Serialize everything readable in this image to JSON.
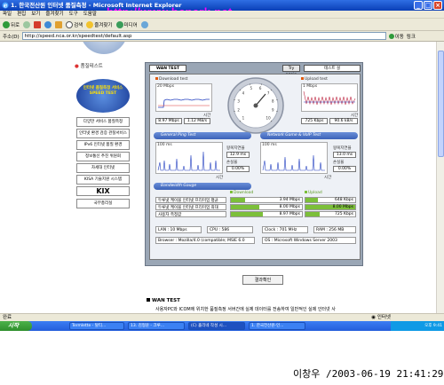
{
  "window": {
    "title": "1. 한국전산원 인터넷 품질측정 - Microsoft Internet Explorer",
    "watermark": "http://www.bcpark.net"
  },
  "menubar": {
    "items": [
      "파일",
      "편집",
      "보기",
      "즐겨찾기",
      "도구",
      "도움말"
    ]
  },
  "toolbar": {
    "back": "뒤로",
    "search": "검색",
    "favorites": "즐겨찾기",
    "media": "미디어"
  },
  "address": {
    "label": "주소(D)",
    "url": "http://speed.nca.or.kr/speedtest/default.asp",
    "go": "이동",
    "links": "링크"
  },
  "sidebar": {
    "title": "품질테스트",
    "banner": "인터넷 품질측정 서비스 SPEED TEST",
    "buttons": [
      {
        "label": "다양한 서비스 품질측정",
        "color": "#ffffff"
      },
      {
        "label": "인터넷 환경 검증 관찰서비스",
        "color": "#e4e8ff"
      },
      {
        "label": "IPv6 인터넷 품질 환경",
        "color": "#ffd0d0"
      },
      {
        "label": "정보통신 추진 위원회",
        "color": "#ffe8c0"
      },
      {
        "label": "차세대 인터넷",
        "color": "#fff0a0"
      },
      {
        "label": "KISA 기술지원 시스템",
        "color": "#e0ffe0"
      },
      {
        "label": "KIX",
        "color": "#ffffff"
      },
      {
        "label": "국무총리실",
        "color": "#ffffff"
      }
    ]
  },
  "applet": {
    "tab": "WAN TEST",
    "again_button": "Try again",
    "server_select": "테스트 설",
    "download": {
      "title": "Download test",
      "scale": "20 Mbps",
      "time_label": "시간",
      "rate": "8.97 Mbps",
      "rate2": "1.12 MB/s"
    },
    "upload": {
      "title": "Upload test",
      "scale": "1 Mbps",
      "time_label": "시간",
      "rate": "725 Kbps",
      "rate2": "90.6 kB/s"
    },
    "gauge": {
      "tick_labels": [
        "1",
        "2",
        "3",
        "4",
        "5",
        "6",
        "7",
        "8",
        "9",
        "10"
      ]
    },
    "general_ping": {
      "title": "General Ping Test",
      "scale": "100 ms",
      "time_label": "시간",
      "avg_label": "왕복지연율",
      "avg_value": "12.9 ms",
      "loss_label": "손실율",
      "loss_value": "0.00%"
    },
    "game_voip": {
      "title": "Network Game & VoIP Test",
      "scale": "100 ms",
      "time_label": "시간",
      "avg_label": "왕복지연율",
      "avg_value": "13.0 ms",
      "loss_label": "손실율",
      "loss_value": "0.00%"
    },
    "bandwidth": {
      "title": "Bandwidth Gauge",
      "download_header": "Download",
      "upload_header": "Upload",
      "rows": [
        {
          "label": "두루넷 케이블 인터넷 프리미엄 평균",
          "down": "3.94 Mbps",
          "down_frac": 0.2,
          "up": "648 Kbps",
          "up_frac": 0.25
        },
        {
          "label": "두루넷 케이블 인터넷 프리미엄 최대",
          "down": "8.00 Mbps",
          "down_frac": 0.4,
          "up": "8.00 Mbps",
          "up_frac": 1.0
        },
        {
          "label": "사용자 측정값",
          "down": "8.97 Mbps",
          "down_frac": 0.45,
          "up": "725 Kbps",
          "up_frac": 0.28
        }
      ]
    },
    "system": {
      "lan_label": "LAN",
      "lan_value": "10 Mbps",
      "cpu_label": "CPU",
      "cpu_value": "586",
      "clock_label": "Clock",
      "clock_value": "701 MHz",
      "ram_label": "RAM",
      "ram_value": "256 MB",
      "browser_label": "Browser",
      "browser_value": "Mozilla/4.0 (compatible; MSIE 6.0",
      "os_label": "OS",
      "os_value": "Microsoft Windows Server 2003"
    }
  },
  "confirm_button": "결과확인",
  "wan_section": {
    "heading": "WAN TEST",
    "text": "사용자PC와 ICOM에 위치한 품질측정 서버간에 실제 데이터를 전송하여 일반적인 실제 인터넷 사"
  },
  "statusbar": {
    "left": "완료",
    "zone": "인터넷"
  },
  "taskbar": {
    "start": "시작",
    "tasks": [
      "Termlette - 탈티...",
      "13. 김형윤 - 크루...",
      "(C) 홀리네 작성 시...",
      "1. 한국전산원-인..."
    ],
    "clock": "오후 9:41"
  },
  "stamp": "이창우 /2003-06-19 21:41:29"
}
